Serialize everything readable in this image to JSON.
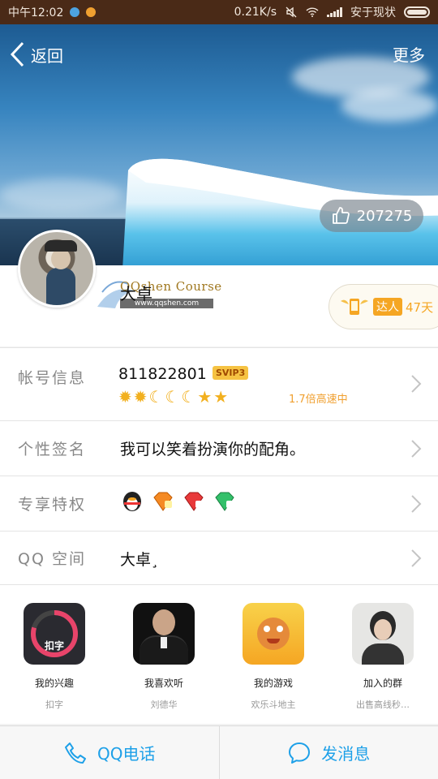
{
  "status_bar": {
    "time": "中午12:02",
    "speed": "0.21K/s",
    "carrier": "安于现状"
  },
  "header": {
    "back_label": "返回",
    "more_label": "更多",
    "likes": "207275"
  },
  "profile": {
    "nickname": "大卓",
    "watermark": "QQshen Course",
    "watermark_url": "www.qqshen.com",
    "badge_label": "达人",
    "badge_days": "47天"
  },
  "rows": {
    "account": {
      "label": "帐号信息",
      "number": "811822801",
      "svip": "SVIP3",
      "level_icons": [
        "sun",
        "sun",
        "moon",
        "moon",
        "moon",
        "star",
        "star"
      ],
      "speed": "1.7倍高速中"
    },
    "signature": {
      "label": "个性签名",
      "value": "我可以笑着扮演你的配角。"
    },
    "privileges": {
      "label": "专享特权",
      "icons": [
        "qq-penguin-icon",
        "orange-diamond-icon",
        "red-diamond-icon",
        "green-diamond-icon"
      ]
    },
    "zone": {
      "label": "QQ 空间",
      "value": "大卓¸"
    }
  },
  "interests": [
    {
      "title": "我的兴趣",
      "subtitle": "扣字",
      "thumb_text": "扣字"
    },
    {
      "title": "我喜欢听",
      "subtitle": "刘德华"
    },
    {
      "title": "我的游戏",
      "subtitle": "欢乐斗地主"
    },
    {
      "title": "加入的群",
      "subtitle": "出售高线秒…"
    }
  ],
  "bottom": {
    "call_label": "QQ电话",
    "message_label": "发消息"
  },
  "colors": {
    "accent": "#1da0e8",
    "status_bar": "#4a2a17",
    "gold": "#f5a623"
  }
}
